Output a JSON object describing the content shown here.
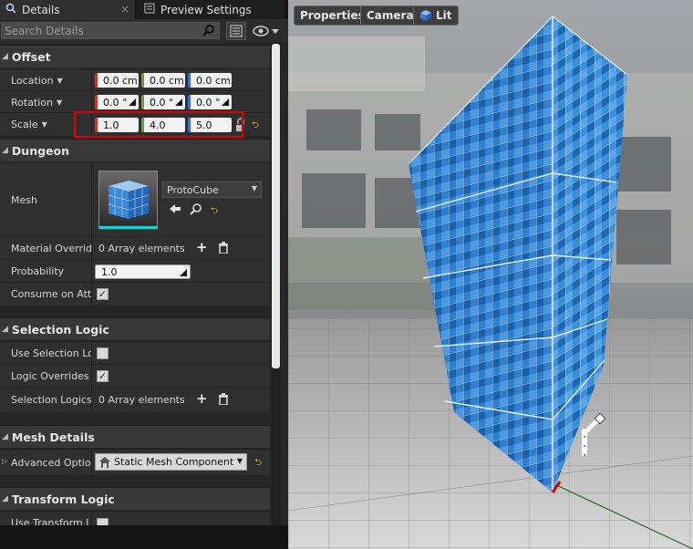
{
  "tabs": [
    {
      "label": "Details",
      "close": "×"
    },
    {
      "label": "Preview Settings"
    }
  ],
  "search": {
    "placeholder": "Search Details"
  },
  "categories": {
    "offset": "Offset",
    "dungeon": "Dungeon",
    "selection_logic": "Selection Logic",
    "mesh_details": "Mesh Details",
    "transform_logic": "Transform Logic"
  },
  "offset": {
    "location": {
      "label": "Location",
      "x": "0.0 cm",
      "y": "0.0 cm",
      "z": "0.0 cm"
    },
    "rotation": {
      "label": "Rotation",
      "x": "0.0 °",
      "y": "0.0 °",
      "z": "0.0 °"
    },
    "scale": {
      "label": "Scale",
      "x": "1.0",
      "y": "4.0",
      "z": "5.0"
    }
  },
  "dungeon": {
    "mesh": {
      "label": "Mesh",
      "value": "ProtoCube"
    },
    "material_override": {
      "label": "Material Override",
      "value": "0 Array elements"
    },
    "probability": {
      "label": "Probability",
      "value": "1.0"
    },
    "consume_on_attach": {
      "label": "Consume on Attach",
      "checked": true
    }
  },
  "selection_logic": {
    "use_selection_logic": {
      "label": "Use Selection Logic",
      "checked": false
    },
    "logic_overrides": {
      "label": "Logic Overrides Affinity",
      "checked": true
    },
    "selection_logics": {
      "label": "Selection Logics",
      "value": "0 Array elements"
    }
  },
  "mesh_details": {
    "advanced_options": {
      "label": "Advanced Options",
      "value": "Static Mesh Component"
    }
  },
  "transform_logic": {
    "use_transform_logic": {
      "label": "Use Transform Logic",
      "checked": false
    }
  },
  "viewport": {
    "buttons": [
      "Properties",
      "Camera",
      "Lit"
    ]
  },
  "colors": {
    "accent_red": "#e00000",
    "axis_x": "#c0392b",
    "axis_y": "#5aa832",
    "axis_z": "#3b6fd6",
    "mesh_blue": "#2f7fd0"
  }
}
